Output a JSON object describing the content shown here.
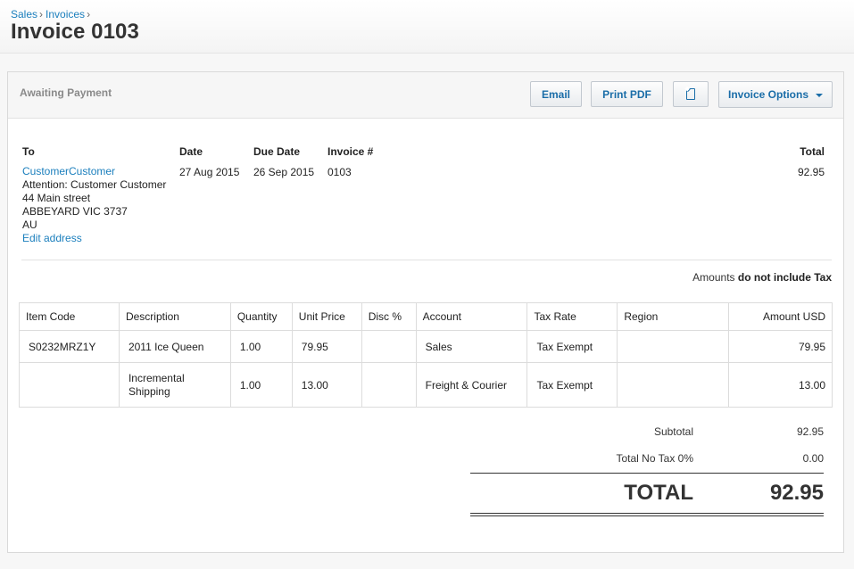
{
  "breadcrumb": [
    {
      "label": "Sales"
    },
    {
      "label": "Invoices"
    }
  ],
  "breadcrumb_sep": "›",
  "page_title": "Invoice 0103",
  "toolbar": {
    "status": "Awaiting Payment",
    "email_label": "Email",
    "pdf_label": "Print PDF",
    "options_label": "Invoice Options"
  },
  "info": {
    "to_label": "To",
    "date_label": "Date",
    "due_label": "Due Date",
    "number_label": "Invoice #",
    "total_label": "Total",
    "customer_name": "CustomerCustomer",
    "attention": "Attention: Customer Customer",
    "street": "44 Main street",
    "city": "ABBEYARD VIC 3737",
    "country": "AU",
    "edit_address": "Edit address",
    "date": "27 Aug 2015",
    "due_date": "26 Sep 2015",
    "number": "0103",
    "total": "92.95"
  },
  "amounts_note": {
    "prefix": "Amounts",
    "value": "do not include Tax"
  },
  "table": {
    "headers": [
      "Item Code",
      "Description",
      "Quantity",
      "Unit Price",
      "Disc %",
      "Account",
      "Tax Rate",
      "Region",
      "Amount USD"
    ],
    "rows": [
      [
        "S0232MRZ1Y",
        "2011 Ice Queen",
        "1.00",
        "79.95",
        "",
        "Sales",
        "Tax Exempt",
        "",
        "79.95"
      ],
      [
        "",
        "Incremental Shipping",
        "1.00",
        "13.00",
        "",
        "Freight & Courier",
        "Tax Exempt",
        "",
        "13.00"
      ]
    ]
  },
  "totals": {
    "subtotal_label": "Subtotal",
    "subtotal": "92.95",
    "tax_label": "Total No Tax 0%",
    "tax": "0.00",
    "total_label": "TOTAL",
    "total": "92.95"
  }
}
